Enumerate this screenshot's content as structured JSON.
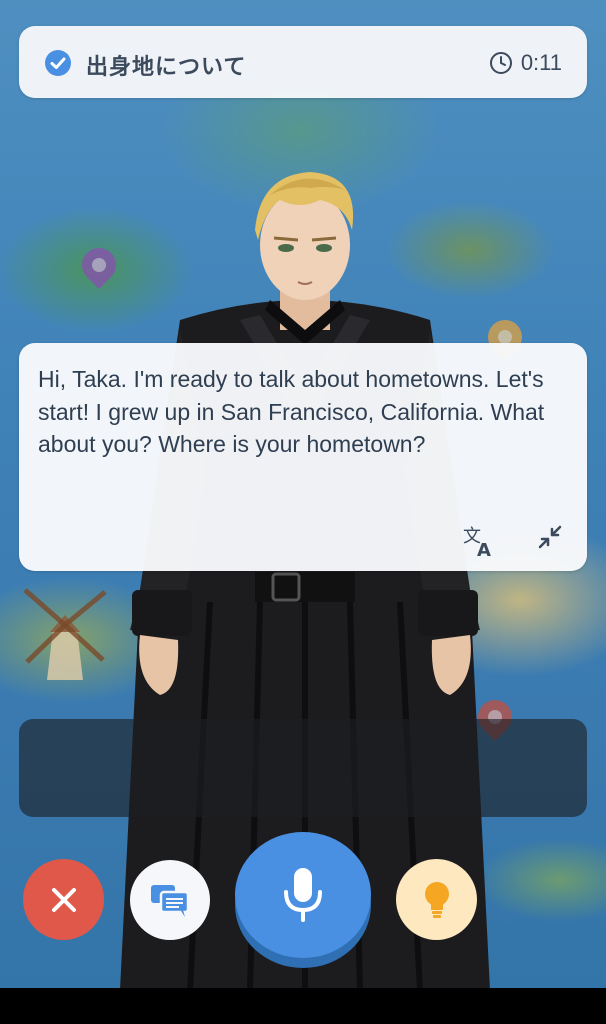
{
  "topic": {
    "title": "出身地について",
    "timer": "0:11"
  },
  "message": {
    "text": "Hi, Taka. I'm ready to talk about hometowns. Let's start! I grew up in San Francisco, California. What about you? Where is your hometown?"
  },
  "controls": {
    "close": "close-icon",
    "chat": "chat-icon",
    "mic": "microphone-icon",
    "hint": "lightbulb-icon"
  },
  "colors": {
    "accent": "#4a90e2",
    "close": "#e05849",
    "hint_bg": "#fde8bf",
    "hint_icon": "#f5a623",
    "text": "#2f3f52"
  }
}
